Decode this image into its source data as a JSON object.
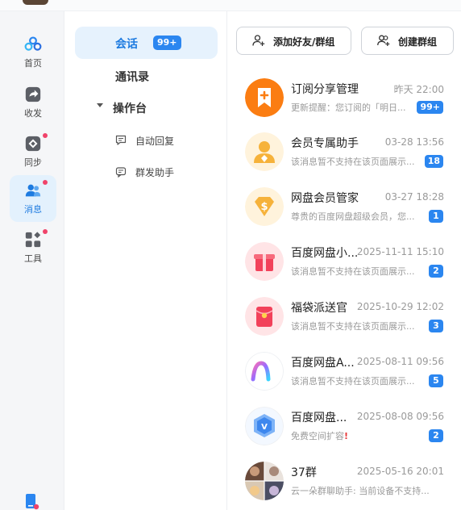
{
  "rail": {
    "items": [
      {
        "label": "首页",
        "icon": "cloud-logo-icon"
      },
      {
        "label": "收发",
        "icon": "share-arrow-icon"
      },
      {
        "label": "同步",
        "icon": "sync-diamond-icon"
      },
      {
        "label": "消息",
        "icon": "people-icon"
      },
      {
        "label": "工具",
        "icon": "grid-icon"
      }
    ]
  },
  "nav": {
    "session_label": "会话",
    "session_badge": "99+",
    "contacts_label": "通讯录",
    "tools_label": "操作台",
    "auto_reply_label": "自动回复",
    "broadcast_label": "群发助手"
  },
  "toolbar": {
    "add_friend_label": "添加好友/群组",
    "create_group_label": "创建群组"
  },
  "conversations": [
    {
      "name": "订阅分享管理",
      "time": "昨天 22:00",
      "preview": "更新提醒：您订阅的「明日...",
      "count": "99+"
    },
    {
      "name": "会员专属助手",
      "time": "03-28 13:56",
      "preview": "该消息暂不支持在该页面展示...",
      "count": "18"
    },
    {
      "name": "网盘会员管家",
      "time": "03-27 18:28",
      "preview": "尊贵的百度网盘超级会员，您...",
      "count": "1"
    },
    {
      "name": "百度网盘小...",
      "time": "2025-11-11 15:10",
      "preview": "该消息暂不支持在该页面展示...",
      "count": "2"
    },
    {
      "name": "福袋派送官",
      "time": "2025-10-29 12:02",
      "preview": "该消息暂不支持在该页面展示...",
      "count": "3"
    },
    {
      "name": "百度网盘A...",
      "time": "2025-08-11 09:56",
      "preview": "该消息暂不支持在该页面展示...",
      "count": "5"
    },
    {
      "name": "百度网盘...",
      "time": "2025-08-08 09:56",
      "preview": "免费空间扩容",
      "preview_mark": "!",
      "count": "2"
    },
    {
      "name": "37群",
      "time": "2025-05-16 20:01",
      "preview": "云一朵群聊助手: 当前设备不支持...",
      "count": ""
    }
  ],
  "colors": {
    "accent": "#2b86f0",
    "active_bg": "#e3f1fd",
    "alert_dot": "#f0436a"
  }
}
